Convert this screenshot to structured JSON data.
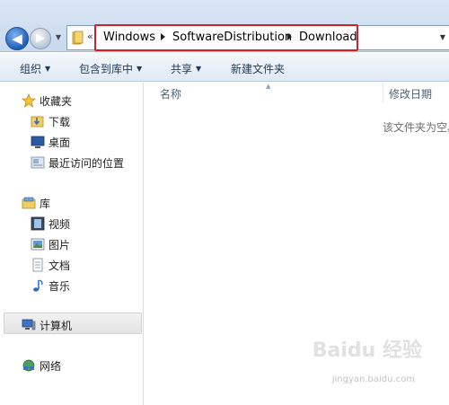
{
  "address": {
    "chevron": "«",
    "crumbs": [
      "Windows",
      "SoftwareDistribution",
      "Download"
    ]
  },
  "commands": [
    {
      "label": "组织",
      "dropdown": true
    },
    {
      "label": "包含到库中",
      "dropdown": true
    },
    {
      "label": "共享",
      "dropdown": true
    },
    {
      "label": "新建文件夹",
      "dropdown": false
    }
  ],
  "nav": {
    "favorites_label": "收藏夹",
    "downloads": "下载",
    "desktop": "桌面",
    "recent": "最近访问的位置",
    "libraries_label": "库",
    "videos": "视频",
    "pictures": "图片",
    "documents": "文档",
    "music": "音乐",
    "computer": "计算机",
    "network": "网络"
  },
  "content": {
    "columns": [
      "名称",
      "修改日期"
    ],
    "empty_message": "该文件夹为空。"
  },
  "watermark": {
    "logo": "Baidu 经验",
    "url": "jingyan.baidu.com"
  },
  "colors": {
    "highlight_box": "#d4202c",
    "accent": "#1f5fb8"
  }
}
